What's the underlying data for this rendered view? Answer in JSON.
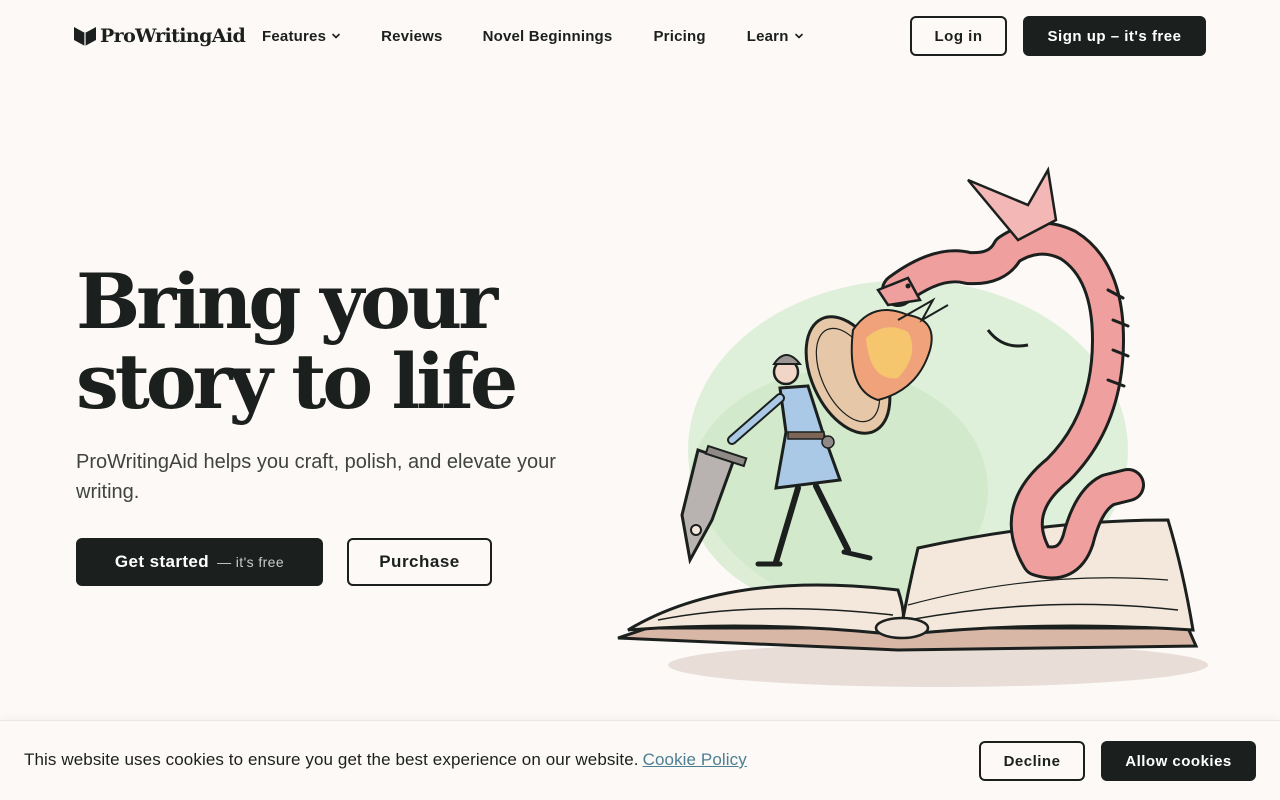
{
  "brand": {
    "name": "ProWritingAid",
    "logo_icon": "open-book-logo-icon"
  },
  "nav": {
    "items": [
      {
        "label": "Features",
        "has_dropdown": true
      },
      {
        "label": "Reviews",
        "has_dropdown": false
      },
      {
        "label": "Novel Beginnings",
        "has_dropdown": false
      },
      {
        "label": "Pricing",
        "has_dropdown": false
      },
      {
        "label": "Learn",
        "has_dropdown": true
      }
    ],
    "login_label": "Log in",
    "signup_label": "Sign up – it's free"
  },
  "hero": {
    "title_line1": "Bring your",
    "title_line2": "story to life",
    "subtitle": "ProWritingAid helps you craft, polish, and elevate your writing.",
    "cta_primary_main": "Get started",
    "cta_primary_aside": "— it's free",
    "cta_secondary": "Purchase",
    "illustration": "knight-fighting-dragon-on-open-book"
  },
  "cookie": {
    "message": "This website uses cookies to ensure you get the best experience on our website.",
    "link_label": "Cookie Policy",
    "decline_label": "Decline",
    "allow_label": "Allow cookies"
  },
  "colors": {
    "background": "#fcf9f6",
    "ink": "#1b201e",
    "link": "#4d7f92",
    "dragon": "#ee9f9e",
    "tunic": "#a9c9e6",
    "watercolor_green": "#cfe8c4"
  }
}
